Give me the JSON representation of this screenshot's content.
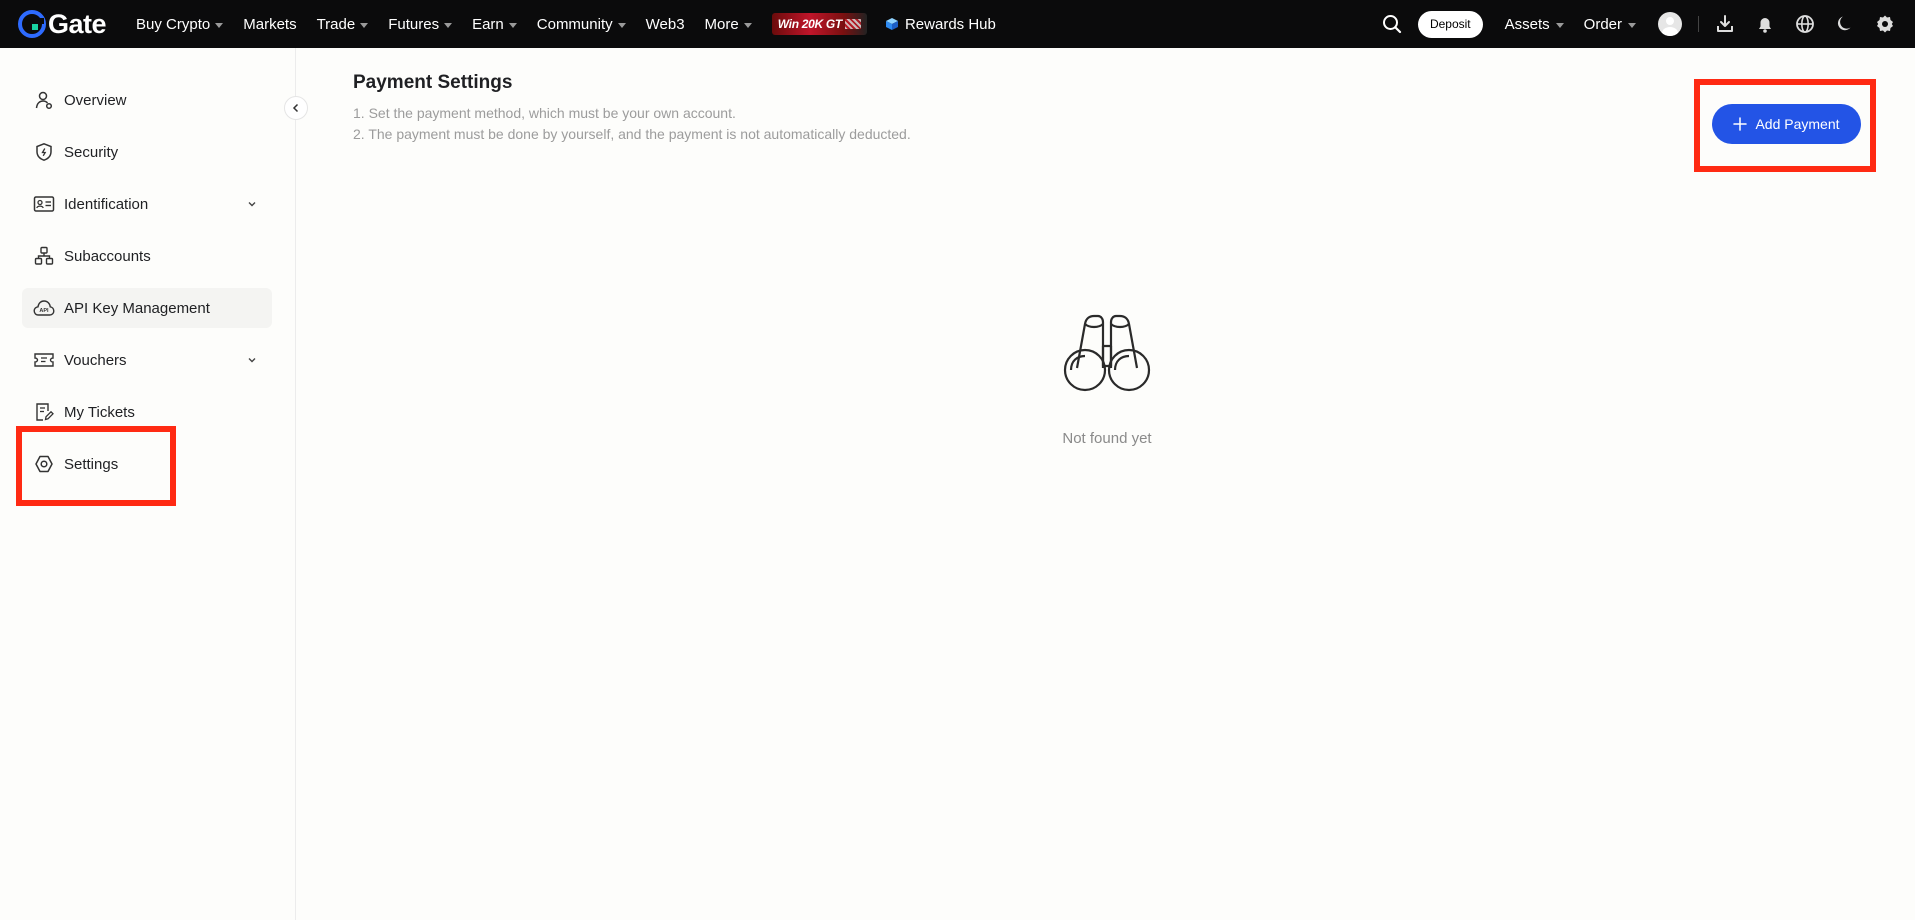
{
  "topbar": {
    "logo_text": "Gate",
    "nav": [
      {
        "label": "Buy Crypto",
        "caret": true
      },
      {
        "label": "Markets",
        "caret": false
      },
      {
        "label": "Trade",
        "caret": true
      },
      {
        "label": "Futures",
        "caret": true
      },
      {
        "label": "Earn",
        "caret": true
      },
      {
        "label": "Community",
        "caret": true
      },
      {
        "label": "Web3",
        "caret": false
      },
      {
        "label": "More",
        "caret": true
      }
    ],
    "promo_text": "Win 20K GT",
    "rewards_label": "Rewards Hub",
    "deposit_label": "Deposit",
    "assets_label": "Assets",
    "order_label": "Order"
  },
  "sidebar": {
    "items": [
      {
        "label": "Overview",
        "icon": "user-icon"
      },
      {
        "label": "Security",
        "icon": "shield-icon"
      },
      {
        "label": "Identification",
        "icon": "id-card-icon",
        "expandable": true
      },
      {
        "label": "Subaccounts",
        "icon": "subaccounts-icon"
      },
      {
        "label": "API Key Management",
        "icon": "api-cloud-icon",
        "active": true
      },
      {
        "label": "Vouchers",
        "icon": "voucher-icon",
        "expandable": true
      },
      {
        "label": "My Tickets",
        "icon": "ticket-icon"
      },
      {
        "label": "Settings",
        "icon": "settings-gear-icon"
      }
    ]
  },
  "main": {
    "title": "Payment Settings",
    "notes": [
      "1. Set the payment method, which must be your own account.",
      "2. The payment must be done by yourself, and the payment is not automatically deducted."
    ],
    "add_button_label": "Add Payment",
    "empty_text": "Not found yet"
  },
  "colors": {
    "topbar_bg": "#0b0b0c",
    "accent_blue": "#2354e6",
    "highlight_red": "#ff2a13",
    "page_bg": "#fdfdfb"
  }
}
